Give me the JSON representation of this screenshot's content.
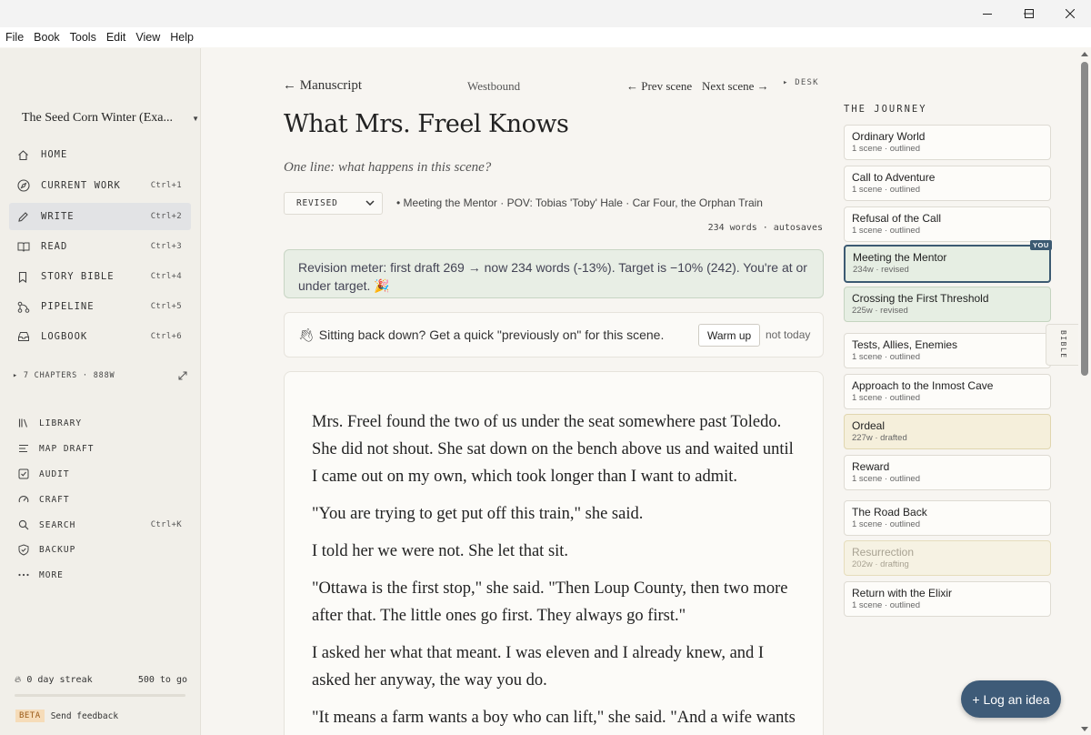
{
  "menu": [
    "File",
    "Book",
    "Tools",
    "Edit",
    "View",
    "Help"
  ],
  "sidebar": {
    "project_title": "The Seed Corn Winter (Exa...",
    "nav": [
      {
        "label": "HOME",
        "shortcut": "",
        "icon": "home-icon"
      },
      {
        "label": "CURRENT WORK",
        "shortcut": "Ctrl+1",
        "icon": "compass-icon"
      },
      {
        "label": "WRITE",
        "shortcut": "Ctrl+2",
        "icon": "pencil-icon",
        "active": true
      },
      {
        "label": "READ",
        "shortcut": "Ctrl+3",
        "icon": "book-open-icon"
      },
      {
        "label": "STORY BIBLE",
        "shortcut": "Ctrl+4",
        "icon": "bookmark-icon"
      },
      {
        "label": "PIPELINE",
        "shortcut": "Ctrl+5",
        "icon": "branch-icon"
      },
      {
        "label": "LOGBOOK",
        "shortcut": "Ctrl+6",
        "icon": "inbox-icon"
      }
    ],
    "chapters_summary": "▸ 7 CHAPTERS · 888W",
    "tools": [
      {
        "label": "LIBRARY",
        "shortcut": "",
        "icon": "library-icon"
      },
      {
        "label": "MAP DRAFT",
        "shortcut": "",
        "icon": "lines-icon"
      },
      {
        "label": "AUDIT",
        "shortcut": "",
        "icon": "checkbox-icon"
      },
      {
        "label": "CRAFT",
        "shortcut": "",
        "icon": "gauge-icon"
      },
      {
        "label": "SEARCH",
        "shortcut": "Ctrl+K",
        "icon": "search-icon"
      },
      {
        "label": "BACKUP",
        "shortcut": "",
        "icon": "shield-check-icon"
      },
      {
        "label": "MORE",
        "shortcut": "",
        "icon": "dots-icon"
      }
    ],
    "streak_label": "0 day streak",
    "streak_goal": "500 to go",
    "streak_progress": 0.0,
    "beta_tag": "BETA",
    "feedback_label": "Send feedback"
  },
  "editor": {
    "back_label": "← Manuscript",
    "book_name": "Westbound",
    "prev_label": "← Prev scene",
    "next_label": "Next scene →",
    "desk_label": "▸ DESK",
    "scene_title": "What Mrs. Freel Knows",
    "oneline_placeholder": "One line: what happens in this scene?",
    "status_value": "REVISED",
    "meta": "•   Meeting the Mentor · POV: Tobias 'Toby' Hale · Car Four, the Orphan Train",
    "word_count": "234 words · autosaves",
    "revision_meter": "Revision meter: first draft 269 → now 234 words (-13%). Target is −10% (242). You're at or under target. 🎉",
    "warmup_prompt": "Sitting back down? Get a quick \"previously on\" for this scene.",
    "warmup_button": "Warm up",
    "warmup_skip": "not today",
    "paragraphs": [
      "Mrs. Freel found the two of us under the seat somewhere past Toledo. She did not shout. She sat down on the bench above us and waited until I came out on my own, which took longer than I want to admit.",
      "\"You are trying to get put off this train,\" she said.",
      "I told her we were not. She let that sit.",
      "\"Ottawa is the first stop,\" she said. \"Then Loup County, then two more after that. The little ones go first. They always go first.\"",
      "I asked her what that meant. I was eleven and I already knew, and I asked her anyway, the way you do.",
      "\"It means a farm wants a boy who can lift,\" she said. \"And a wife wants"
    ]
  },
  "journey": {
    "title": "THE JOURNEY",
    "you_badge": "YOU",
    "bible_tab": "BIBLE",
    "beats": [
      {
        "name": "Ordinary World",
        "sub": "1 scene · outlined",
        "state": "outlined"
      },
      {
        "name": "Call to Adventure",
        "sub": "1 scene · outlined",
        "state": "outlined"
      },
      {
        "name": "Refusal of the Call",
        "sub": "1 scene · outlined",
        "state": "outlined"
      },
      {
        "name": "Meeting the Mentor",
        "sub": "234w · revised",
        "state": "revised current"
      },
      {
        "name": "Crossing the First Threshold",
        "sub": "225w · revised",
        "state": "revised"
      },
      {
        "name": "Tests, Allies, Enemies",
        "sub": "1 scene · outlined",
        "state": "outlined"
      },
      {
        "name": "Approach to the Inmost Cave",
        "sub": "1 scene · outlined",
        "state": "outlined"
      },
      {
        "name": "Ordeal",
        "sub": "227w · drafted",
        "state": "drafted"
      },
      {
        "name": "Reward",
        "sub": "1 scene · outlined",
        "state": "outlined"
      },
      {
        "name": "The Road Back",
        "sub": "1 scene · outlined",
        "state": "outlined"
      },
      {
        "name": "Resurrection",
        "sub": "202w · drafting",
        "state": "drafting"
      },
      {
        "name": "Return with the Elixir",
        "sub": "1 scene · outlined",
        "state": "outlined"
      }
    ]
  },
  "fab_label": "+ Log an idea",
  "colors": {
    "accent": "#3e5b78",
    "revised": "#e6eee3",
    "drafted": "#f5efdb",
    "beta": "#f6dcb9"
  }
}
